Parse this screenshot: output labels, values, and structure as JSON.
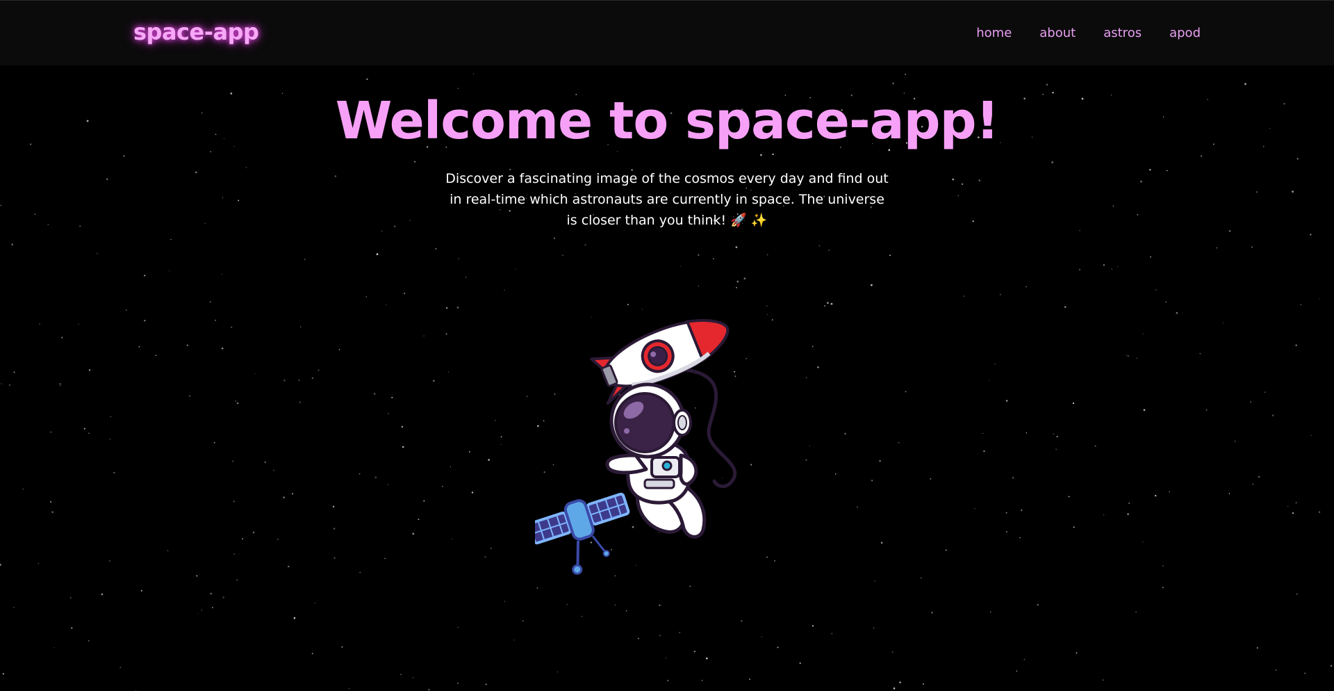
{
  "nav": {
    "logo": "space-app",
    "links": [
      "home",
      "about",
      "astros",
      "apod"
    ]
  },
  "hero": {
    "title": "Welcome to space-app!",
    "description": "Discover a fascinating image of the cosmos every day and find out in real-time which astronauts are currently in space. The universe is closer than you think! 🚀 ✨"
  },
  "colors": {
    "background": "#000000",
    "navbar": "#0b0b0b",
    "accent_pink": "#f7a0f7",
    "nav_link": "#e9a0f3",
    "text": "#ffffff"
  },
  "illustration": {
    "icon": "astronaut-with-rocket-and-satellite-illustration"
  }
}
